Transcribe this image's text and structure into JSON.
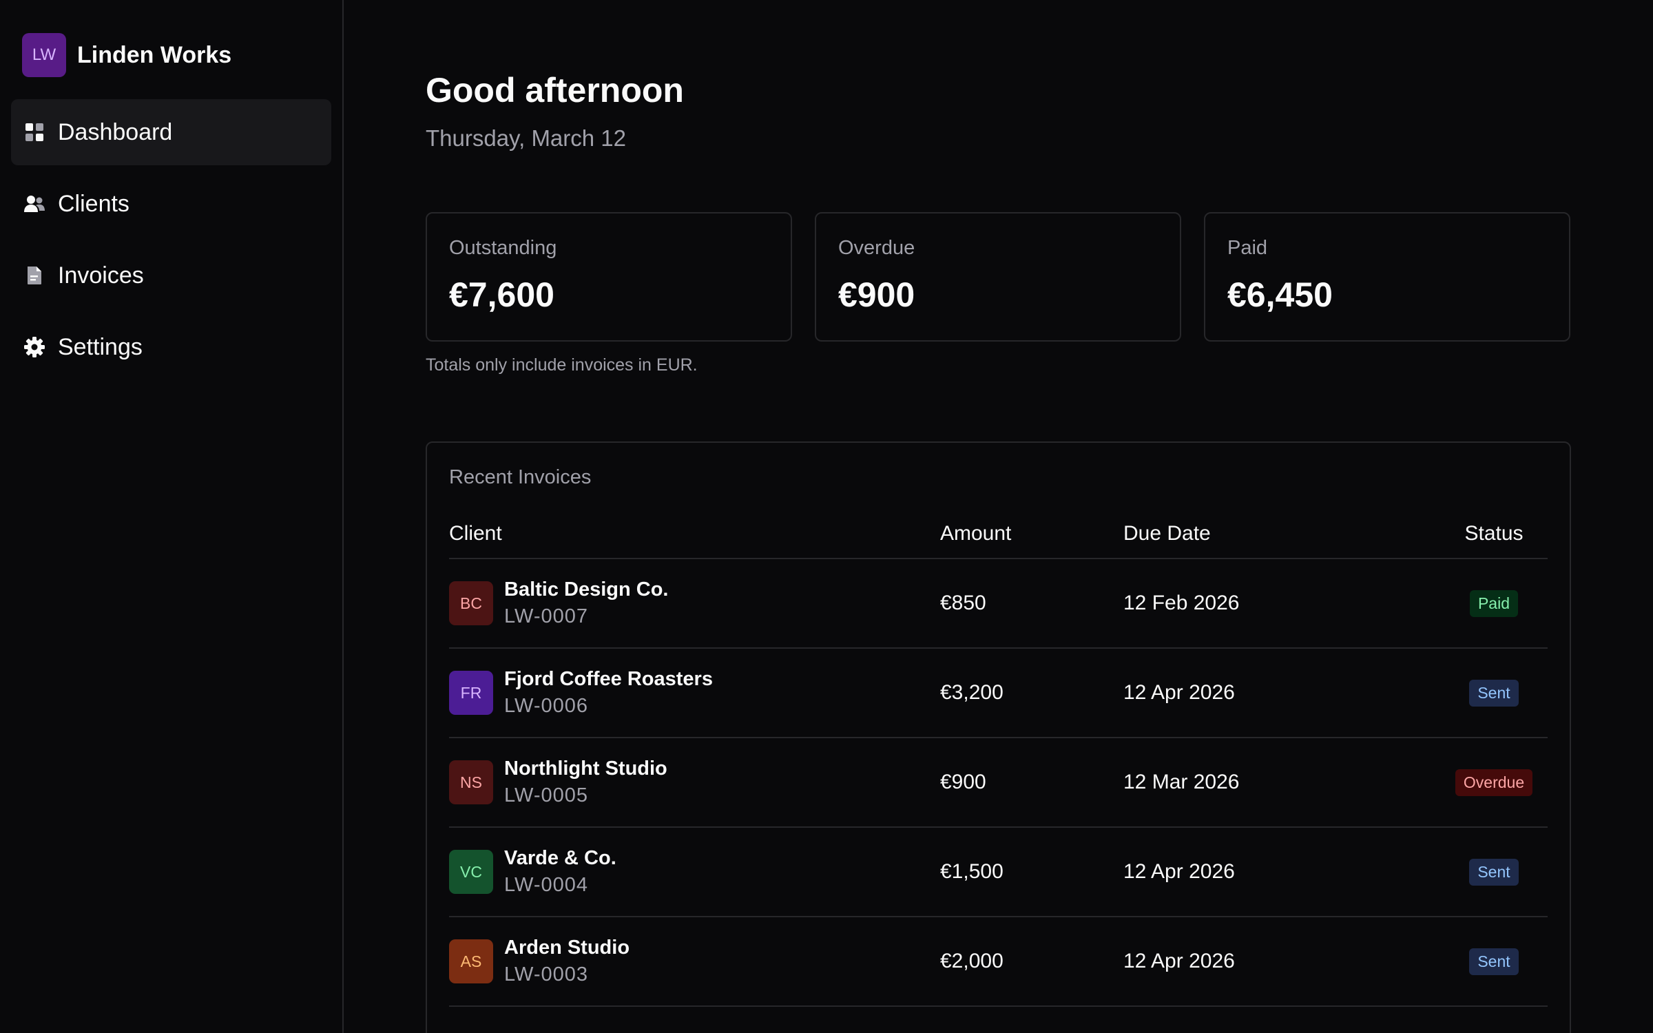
{
  "brand": {
    "initials": "LW",
    "name": "Linden Works"
  },
  "nav": [
    {
      "key": "dashboard",
      "label": "Dashboard",
      "icon": "dashboard-icon",
      "active": true
    },
    {
      "key": "clients",
      "label": "Clients",
      "icon": "users-icon",
      "active": false
    },
    {
      "key": "invoices",
      "label": "Invoices",
      "icon": "document-icon",
      "active": false
    },
    {
      "key": "settings",
      "label": "Settings",
      "icon": "gear-icon",
      "active": false
    }
  ],
  "header": {
    "greeting": "Good afternoon",
    "date": "Thursday, March 12"
  },
  "stats": [
    {
      "label": "Outstanding",
      "value": "€7,600"
    },
    {
      "label": "Overdue",
      "value": "€900"
    },
    {
      "label": "Paid",
      "value": "€6,450"
    }
  ],
  "stats_note": "Totals only include invoices in EUR.",
  "recent_invoices": {
    "title": "Recent Invoices",
    "columns": {
      "client": "Client",
      "amount": "Amount",
      "due": "Due Date",
      "status": "Status"
    },
    "rows": [
      {
        "initials": "BC",
        "client": "Baltic Design Co.",
        "id": "LW-0007",
        "amount": "€850",
        "due": "12 Feb 2026",
        "status": "Paid"
      },
      {
        "initials": "FR",
        "client": "Fjord Coffee Roasters",
        "id": "LW-0006",
        "amount": "€3,200",
        "due": "12 Apr 2026",
        "status": "Sent"
      },
      {
        "initials": "NS",
        "client": "Northlight Studio",
        "id": "LW-0005",
        "amount": "€900",
        "due": "12 Mar 2026",
        "status": "Overdue"
      },
      {
        "initials": "VC",
        "client": "Varde & Co.",
        "id": "LW-0004",
        "amount": "€1,500",
        "due": "12 Apr 2026",
        "status": "Sent"
      },
      {
        "initials": "AS",
        "client": "Arden Studio",
        "id": "LW-0003",
        "amount": "€2,000",
        "due": "12 Apr 2026",
        "status": "Sent"
      }
    ]
  },
  "colors": {
    "background": "#09090b",
    "border": "#27272a",
    "muted_text": "#a1a1aa",
    "brand_bg": "#581c87",
    "avatars": {
      "BC": {
        "bg": "#4c1414",
        "fg": "#fca5a5"
      },
      "FR": {
        "bg": "#4c1d95",
        "fg": "#d8b4fe"
      },
      "NS": {
        "bg": "#4c1414",
        "fg": "#fca5a5"
      },
      "VC": {
        "bg": "#14532d",
        "fg": "#86efac"
      },
      "AS": {
        "bg": "#7c2d12",
        "fg": "#fdba74"
      }
    },
    "status": {
      "Paid": {
        "bg": "#052e16",
        "fg": "#86efac"
      },
      "Sent": {
        "bg": "#1e2a4a",
        "fg": "#93c5fd"
      },
      "Overdue": {
        "bg": "#450a0a",
        "fg": "#fca5a5"
      }
    }
  }
}
